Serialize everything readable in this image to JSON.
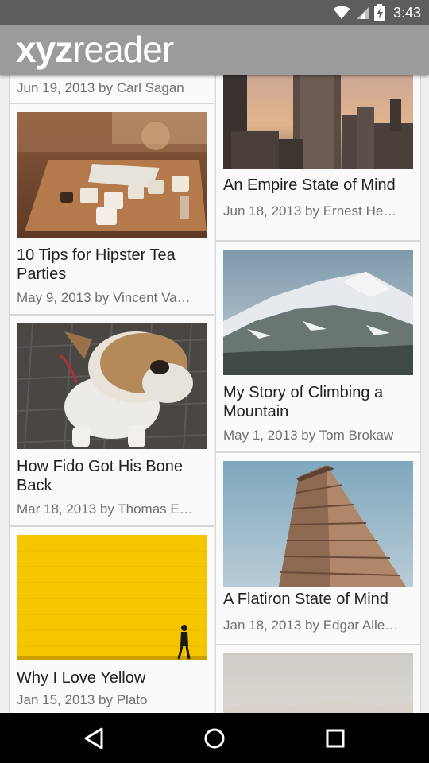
{
  "status_bar": {
    "time": "3:43",
    "icons": [
      "wifi-icon",
      "cell-signal-icon",
      "battery-charging-icon"
    ]
  },
  "app_bar": {
    "logo_bold": "xyz",
    "logo_light": "reader"
  },
  "articles": [
    {
      "title": "",
      "subtitle": "Jun 19, 2013 by Carl Sagan"
    },
    {
      "title": "An Empire State of Mind",
      "subtitle": "Jun 18, 2013 by Ernest He…"
    },
    {
      "title": "10 Tips for Hipster Tea Parties",
      "subtitle": "May 9, 2013 by Vincent Va…"
    },
    {
      "title": "My Story of Climbing a Mountain",
      "subtitle": "May 1, 2013 by Tom Brokaw"
    },
    {
      "title": "How Fido Got His Bone Back",
      "subtitle": "Mar 18, 2013 by Thomas E…"
    },
    {
      "title": "A Flatiron State of Mind",
      "subtitle": "Jan 18, 2013 by Edgar Alle…"
    },
    {
      "title": "Why I Love Yellow",
      "subtitle": "Jan 15, 2013 by Plato"
    },
    {
      "title": "",
      "subtitle": ""
    }
  ],
  "nav_bar": {
    "icons": [
      "back-icon",
      "home-icon",
      "recents-icon"
    ]
  },
  "colors": {
    "status_bar": "#5d5d5d",
    "app_bar": "#9b9b9b",
    "card_bg": "#fafafa",
    "page_bg": "#eeeeee"
  }
}
